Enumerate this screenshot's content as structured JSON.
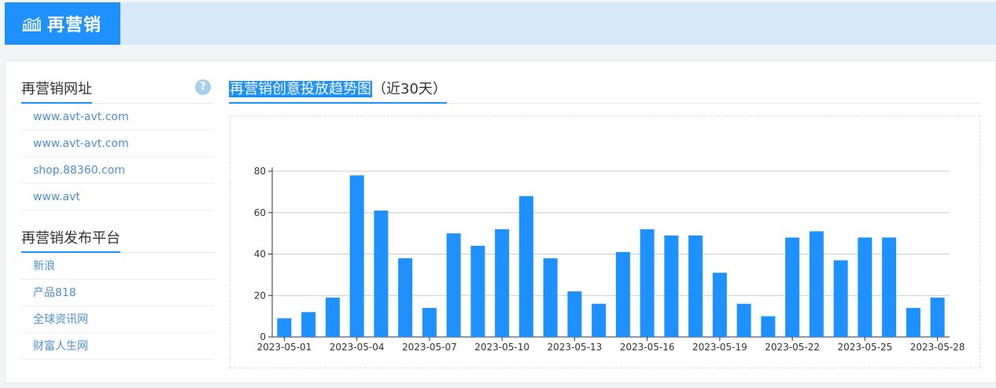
{
  "header": {
    "title": "再营销",
    "icon": "bar-chart-trend-icon"
  },
  "sidebar": {
    "urls": {
      "title": "再营销网址",
      "help": "?",
      "items": [
        "www.avt-avt.com",
        "www.avt-avt.com",
        "shop.88360.com",
        "www.avt"
      ]
    },
    "platforms": {
      "title": "再营销发布平台",
      "items": [
        "新浪",
        "产品818",
        "全球资讯网",
        "财富人生网"
      ]
    }
  },
  "chart_header": {
    "title": "再营销创意投放趋势图",
    "subtitle": "（近30天）"
  },
  "colors": {
    "accent": "#1e90ff",
    "topbar": "#d6eafc",
    "link": "#4a90d6"
  },
  "chart_data": {
    "type": "bar",
    "categories": [
      "2023-05-01",
      "2023-05-02",
      "2023-05-03",
      "2023-05-04",
      "2023-05-05",
      "2023-05-06",
      "2023-05-07",
      "2023-05-08",
      "2023-05-09",
      "2023-05-10",
      "2023-05-11",
      "2023-05-12",
      "2023-05-13",
      "2023-05-14",
      "2023-05-15",
      "2023-05-16",
      "2023-05-17",
      "2023-05-18",
      "2023-05-19",
      "2023-05-20",
      "2023-05-21",
      "2023-05-22",
      "2023-05-23",
      "2023-05-24",
      "2023-05-25",
      "2023-05-26",
      "2023-05-27",
      "2023-05-28"
    ],
    "values": [
      9,
      12,
      19,
      78,
      61,
      38,
      14,
      50,
      44,
      52,
      68,
      38,
      22,
      16,
      41,
      52,
      49,
      49,
      31,
      16,
      10,
      48,
      51,
      37,
      48,
      48,
      14,
      19
    ],
    "xticks": [
      "2023-05-01",
      "2023-05-04",
      "2023-05-07",
      "2023-05-10",
      "2023-05-13",
      "2023-05-16",
      "2023-05-19",
      "2023-05-22",
      "2023-05-25",
      "2023-05-28"
    ],
    "yticks": [
      0,
      20,
      40,
      60,
      80
    ],
    "ylim": [
      0,
      80
    ],
    "grid": true,
    "bar_color": "#1e90ff"
  }
}
